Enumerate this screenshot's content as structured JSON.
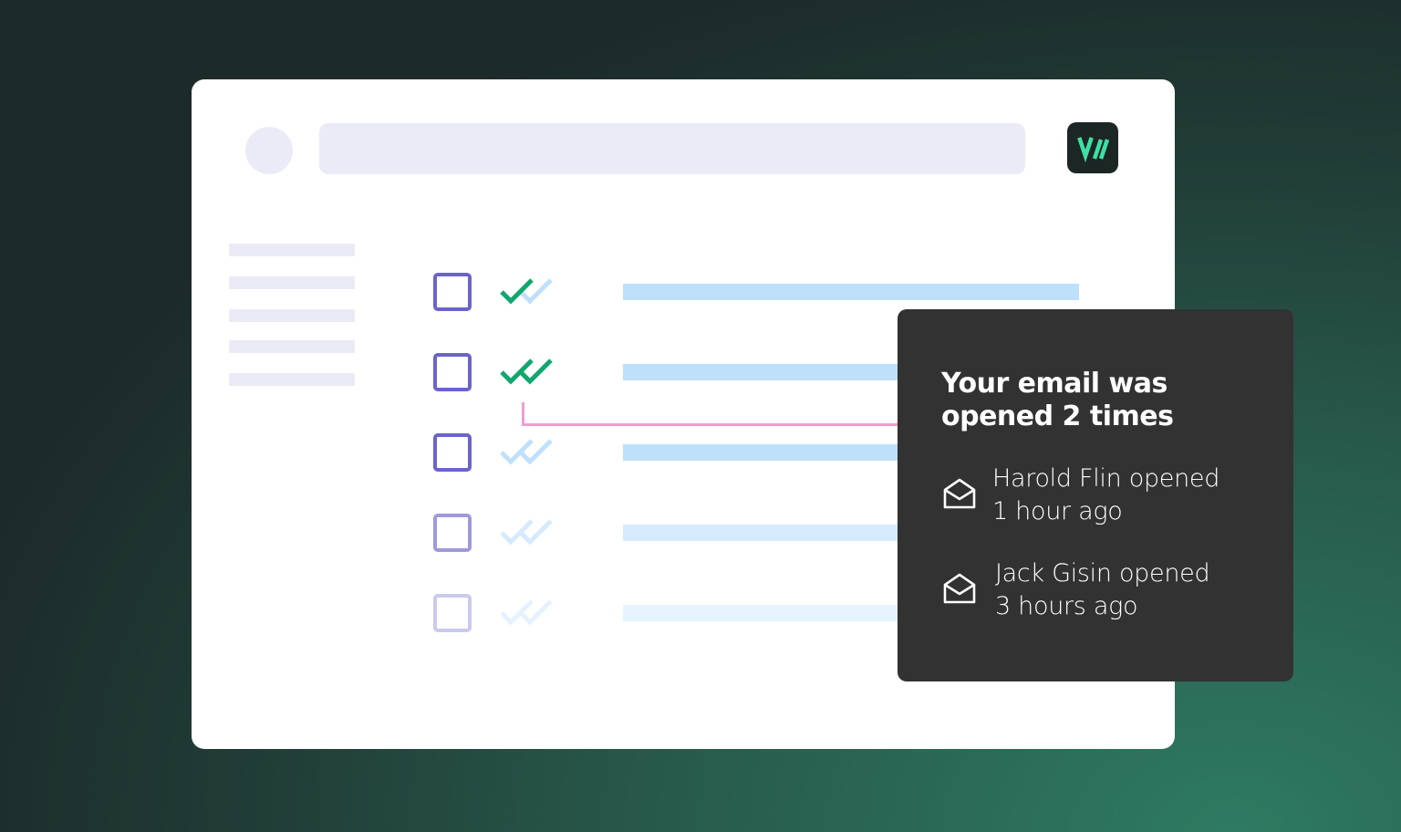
{
  "app": {
    "logo_icon": "app-logo-icon",
    "logo_text": "//",
    "accent_color": "#3ee0a4"
  },
  "mail_list": {
    "rows": [
      {
        "status": "opened",
        "icon": "double-check-icon"
      },
      {
        "status": "opened",
        "icon": "double-check-icon"
      },
      {
        "status": "unopened",
        "icon": "double-check-icon"
      },
      {
        "status": "unopened",
        "icon": "double-check-icon"
      },
      {
        "status": "unopened",
        "icon": "double-check-icon"
      }
    ],
    "status_colors": {
      "opened": "#12a66e",
      "unopened": "#bfe0fb",
      "checkbox": "#6b63c9",
      "connector": "#f39bd0"
    }
  },
  "tracking_popup": {
    "title_line1": "Your email was",
    "title_line2": "opened 2 times",
    "entries": [
      {
        "icon": "open-envelope-icon",
        "line1": "Harold Flin opened",
        "line2": "1 hour ago"
      },
      {
        "icon": "open-envelope-icon",
        "line1": "Jack Gisin opened",
        "line2": "3 hours ago"
      }
    ]
  }
}
